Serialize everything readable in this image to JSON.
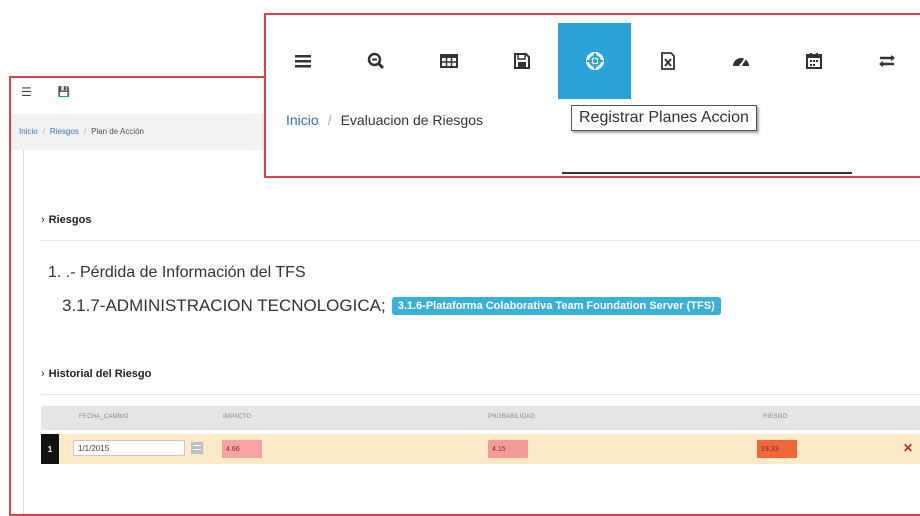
{
  "bg_toolbar": {
    "menu_icon": "menu-icon",
    "save_icon": "save-icon"
  },
  "bg_breadcrumb": {
    "items": [
      "Inicio",
      "Riesgos",
      "Plan de Acción"
    ],
    "separator": "/"
  },
  "riesgos_section": {
    "title": "Riesgos"
  },
  "risk": {
    "line1": "1. .- Pérdida de Información del TFS",
    "line2": "3.1.7-ADMINISTRACION TECNOLOGICA;",
    "badge": "3.1.6-Plataforma Colaborativa Team Foundation Server (TFS)"
  },
  "historial_section": {
    "title": "Historial del Riesgo"
  },
  "history_table": {
    "columns": [
      "FECHA_CAMBIO",
      "IMPACTO",
      "PROBABILIDAD",
      "RIESGO"
    ],
    "rows": [
      {
        "num": "1",
        "fecha": "1/1/2015",
        "impacto": "4.66",
        "probabilidad": "4.15",
        "riesgo": "19.33"
      }
    ],
    "colors": {
      "impacto": "#f7a3a3",
      "probabilidad": "#f79a9a",
      "riesgo": "#f2663a",
      "row_bg": "#fce9c6"
    }
  },
  "callout_toolbar": {
    "buttons": [
      {
        "icon": "menu-icon"
      },
      {
        "icon": "zoom-icon"
      },
      {
        "icon": "table-icon"
      },
      {
        "icon": "save-icon"
      },
      {
        "icon": "life-ring-icon",
        "active": true
      },
      {
        "icon": "excel-icon"
      },
      {
        "icon": "dashboard-icon"
      },
      {
        "icon": "calendar-icon"
      },
      {
        "icon": "swap-icon"
      }
    ],
    "accent": "#2aa3db"
  },
  "callout_breadcrumb": {
    "items": [
      "Inicio",
      "Evaluacion de Riesgos"
    ],
    "separator": "/"
  },
  "tooltip": {
    "text": "Registrar Planes Accion"
  },
  "highlight_color": "#d9434a"
}
